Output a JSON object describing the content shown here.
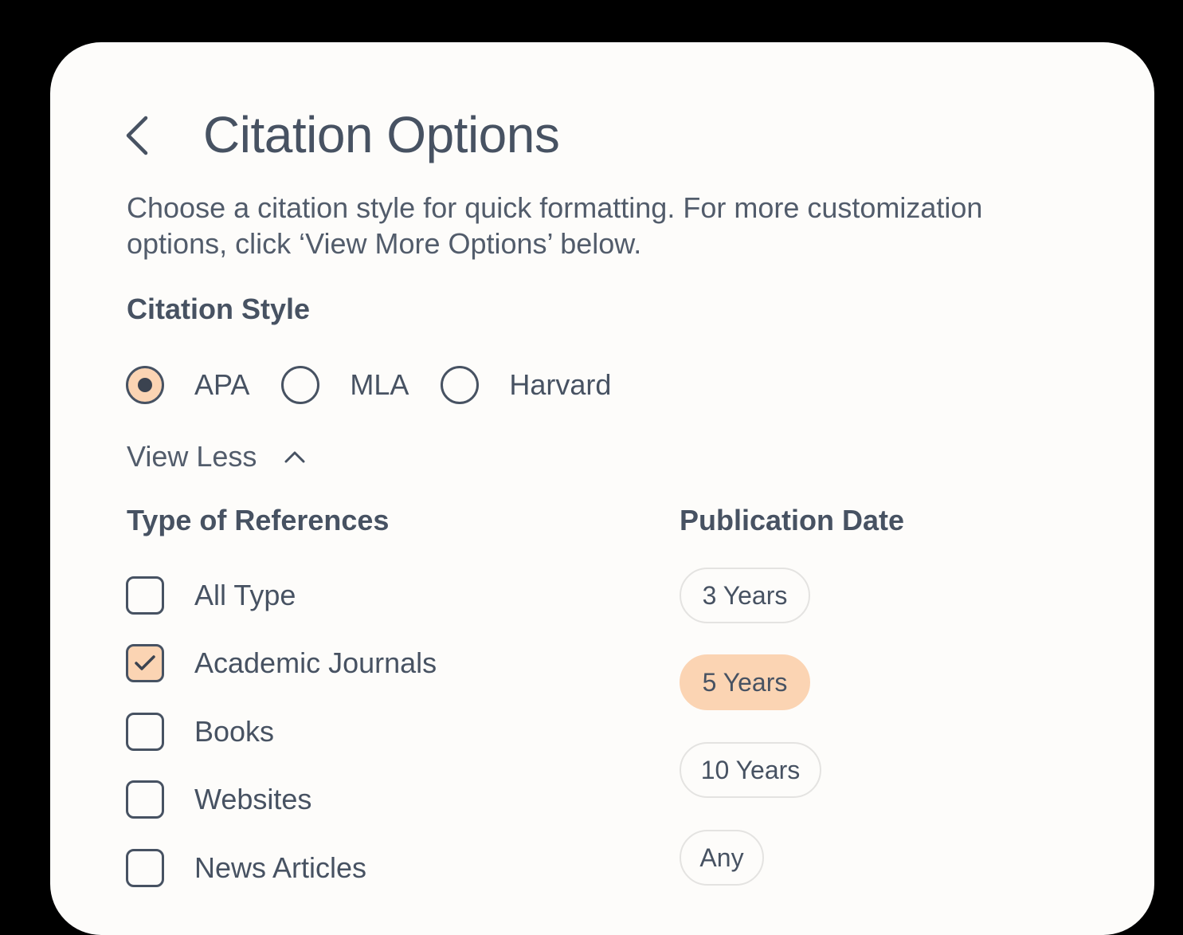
{
  "header": {
    "title": "Citation Options",
    "back_icon": "chevron-left-icon",
    "description": "Choose a citation style for quick formatting. For more customization options, click ‘View More Options’ below."
  },
  "citation_style": {
    "label": "Citation Style",
    "options": [
      {
        "label": "APA",
        "selected": true
      },
      {
        "label": "MLA",
        "selected": false
      },
      {
        "label": "Harvard",
        "selected": false
      }
    ]
  },
  "view_toggle": {
    "label": "View Less",
    "icon": "chevron-up-icon"
  },
  "reference_types": {
    "label": "Type of References",
    "items": [
      {
        "label": "All Type",
        "checked": false
      },
      {
        "label": "Academic Journals",
        "checked": true
      },
      {
        "label": "Books",
        "checked": false
      },
      {
        "label": "Websites",
        "checked": false
      },
      {
        "label": "News Articles",
        "checked": false
      }
    ]
  },
  "publication_date": {
    "label": "Publication Date",
    "options": [
      {
        "label": "3 Years",
        "selected": false
      },
      {
        "label": "5 Years",
        "selected": true
      },
      {
        "label": "10 Years",
        "selected": false
      },
      {
        "label": "Any",
        "selected": false
      }
    ]
  },
  "colors": {
    "accent": "#fbd4b3",
    "text": "#475262",
    "panel": "#fdfcfa",
    "backdrop": "#000000"
  }
}
